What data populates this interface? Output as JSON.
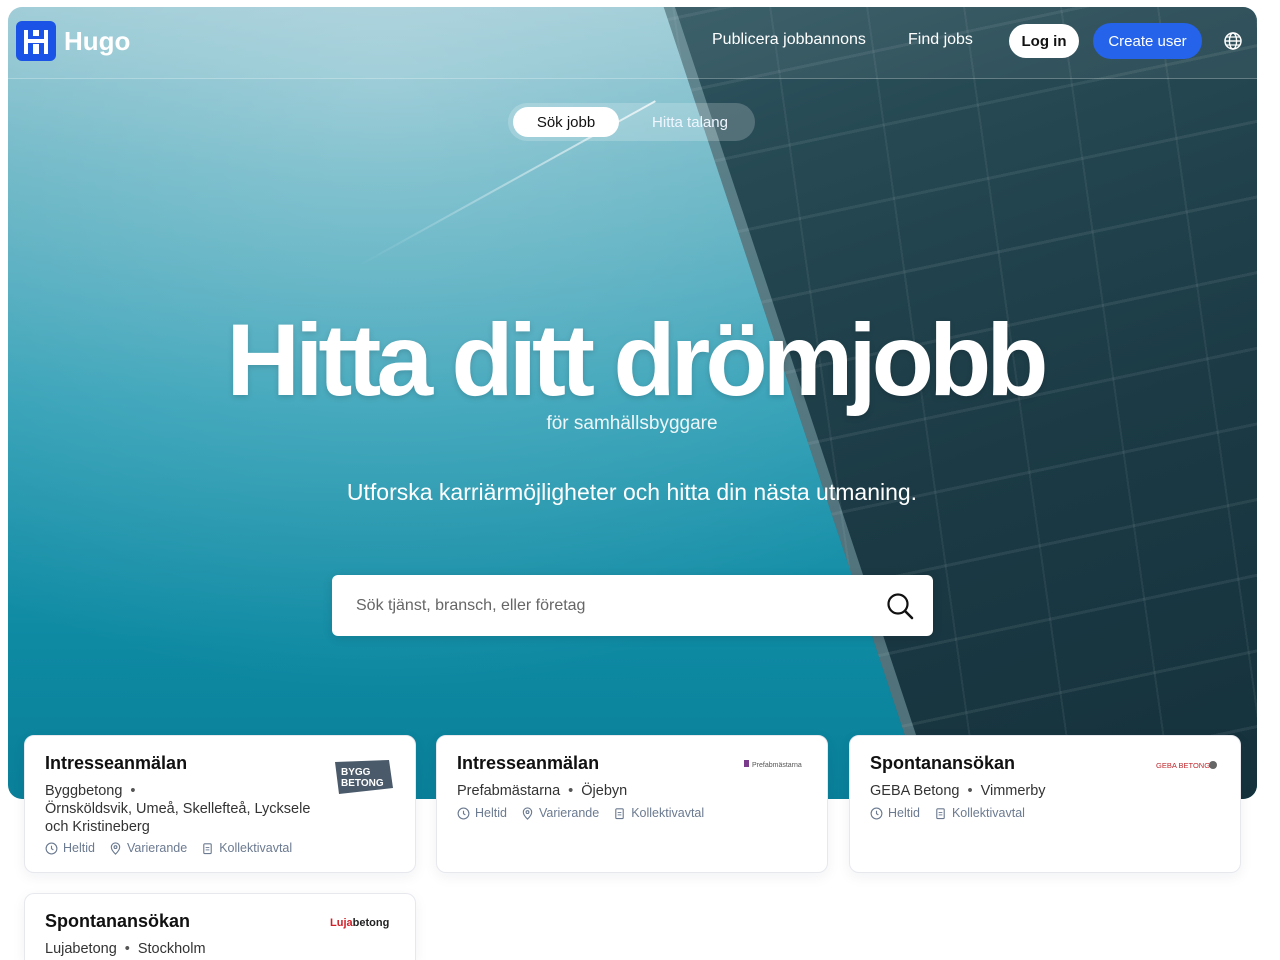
{
  "nav": {
    "brand": "Hugo",
    "brand_mark": "H",
    "links": [
      "Publicera jobbannons",
      "Find jobs"
    ],
    "login": "Log in",
    "create_user": "Create user",
    "language_icon": "globe-icon"
  },
  "toggle": {
    "active": "Sök jobb",
    "inactive": "Hitta talang"
  },
  "hero": {
    "headline": "Hitta ditt drömjobb",
    "subhead": "för samhällsbyggare",
    "tagline": "Utforska karriärmöjligheter och hitta din nästa utmaning."
  },
  "search": {
    "placeholder": "Sök tjänst, bransch, eller företag",
    "icon": "search-icon"
  },
  "cards": [
    {
      "title": "Intresseanmälan",
      "company": "Byggbetong",
      "location": "Örnsköldsvik, Umeå, Skellefteå, Lycksele och Kristineberg",
      "logo_text": [
        "BYGG",
        "BETONG"
      ],
      "tags": [
        "Heltid",
        "Varierande",
        "Kollektivavtal"
      ]
    },
    {
      "title": "Intresseanmälan",
      "company": "Prefabmästarna",
      "location": "Öjebyn",
      "logo_text": [
        "Prefabmästarna"
      ],
      "tags": [
        "Heltid",
        "Varierande",
        "Kollektivavtal"
      ]
    },
    {
      "title": "Spontanansökan",
      "company": "GEBA Betong",
      "location": "Vimmerby",
      "logo_text": [
        "GEBA BETONG"
      ],
      "tags": [
        "Heltid",
        "Kollektivavtal"
      ]
    },
    {
      "title": "Spontanansökan",
      "company": "Lujabetong",
      "location": "Stockholm",
      "logo_text": [
        "Luja",
        "betong"
      ]
    }
  ],
  "colors": {
    "accent": "#2563eb",
    "brand": "#1a53e6",
    "tag_text": "#6b7a90"
  }
}
